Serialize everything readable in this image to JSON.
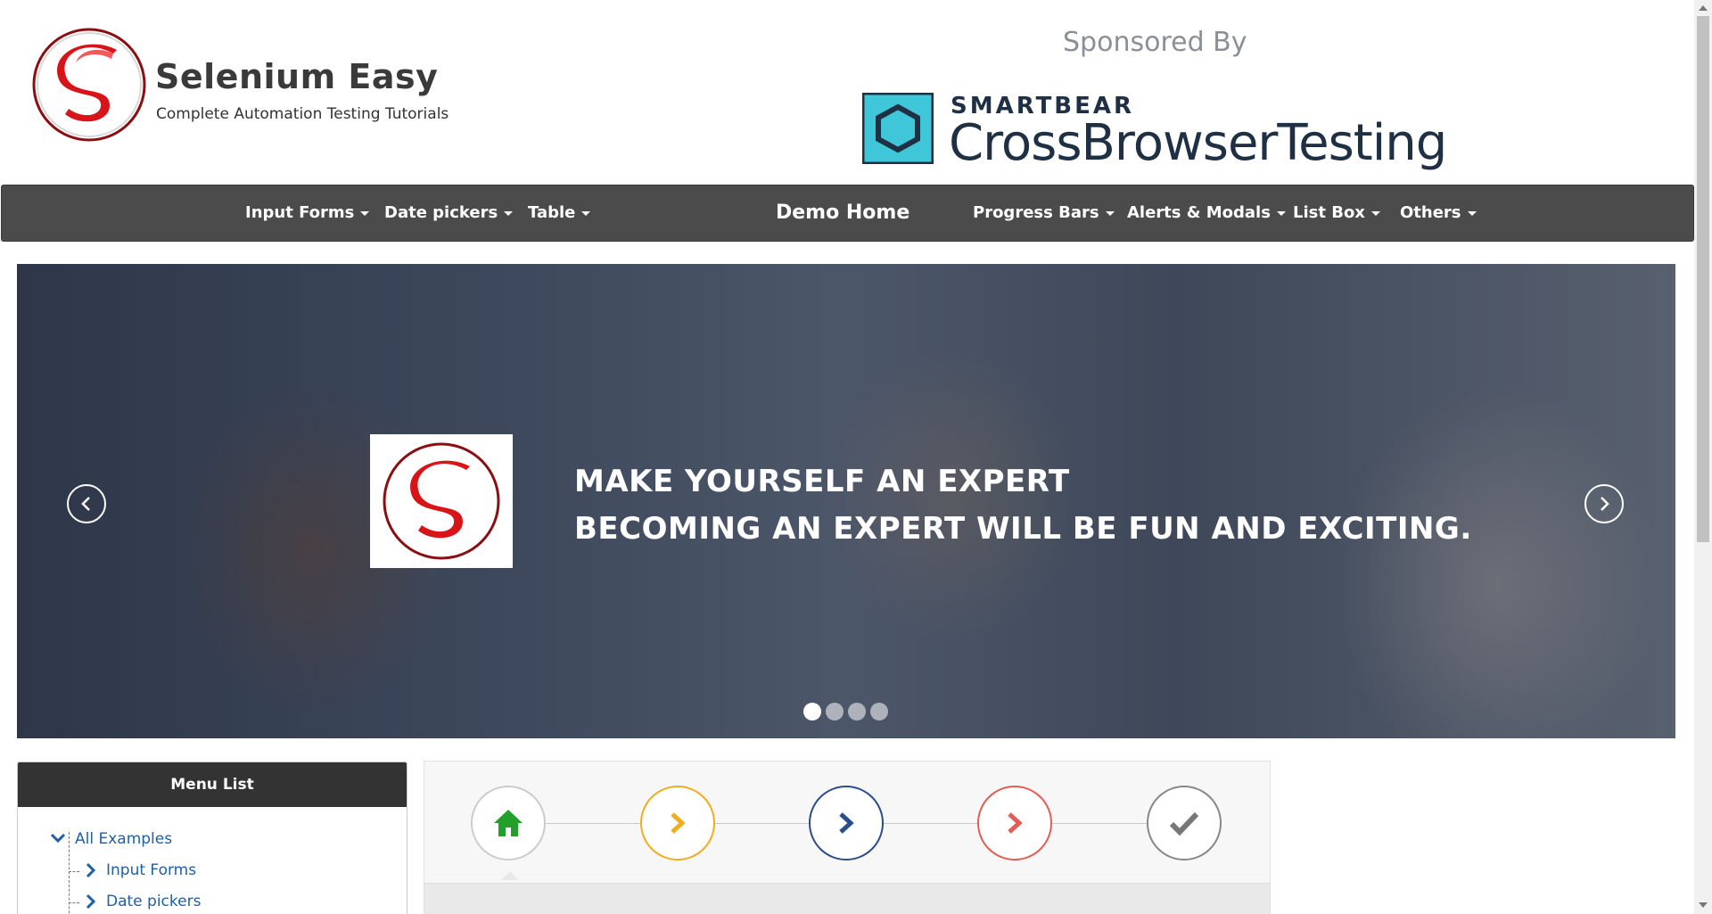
{
  "header": {
    "brand_title": "Selenium Easy",
    "brand_subtitle": "Complete Automation Testing Tutorials",
    "sponsored_label": "Sponsored By",
    "sponsor_small": "SMARTBEAR",
    "sponsor_big": "CrossBrowserTesting"
  },
  "nav": {
    "items": [
      {
        "label": "Input Forms"
      },
      {
        "label": "Date pickers"
      },
      {
        "label": "Table"
      },
      {
        "label": "Demo Home"
      },
      {
        "label": "Progress Bars"
      },
      {
        "label": "Alerts & Modals"
      },
      {
        "label": "List Box"
      },
      {
        "label": "Others"
      }
    ]
  },
  "carousel": {
    "line1": "MAKE YOURSELF AN EXPERT",
    "line2": "BECOMING AN EXPERT WILL BE FUN AND EXCITING.",
    "slides": 4,
    "active_slide": 1
  },
  "menu": {
    "title": "Menu List",
    "items": [
      "All Examples",
      "Input Forms",
      "Date pickers"
    ]
  },
  "wizard": {
    "steps": [
      {
        "icon": "home-icon",
        "color": "#22a02a"
      },
      {
        "icon": "chevron-right-icon",
        "color": "#f0ad1f"
      },
      {
        "icon": "chevron-right-icon",
        "color": "#2b4d8c"
      },
      {
        "icon": "chevron-right-icon",
        "color": "#e35d56"
      },
      {
        "icon": "check-icon",
        "color": "#777777"
      }
    ]
  },
  "colors": {
    "navbar": "#4b4b4b",
    "menu_header": "#333333",
    "link": "#1e5fa8"
  }
}
